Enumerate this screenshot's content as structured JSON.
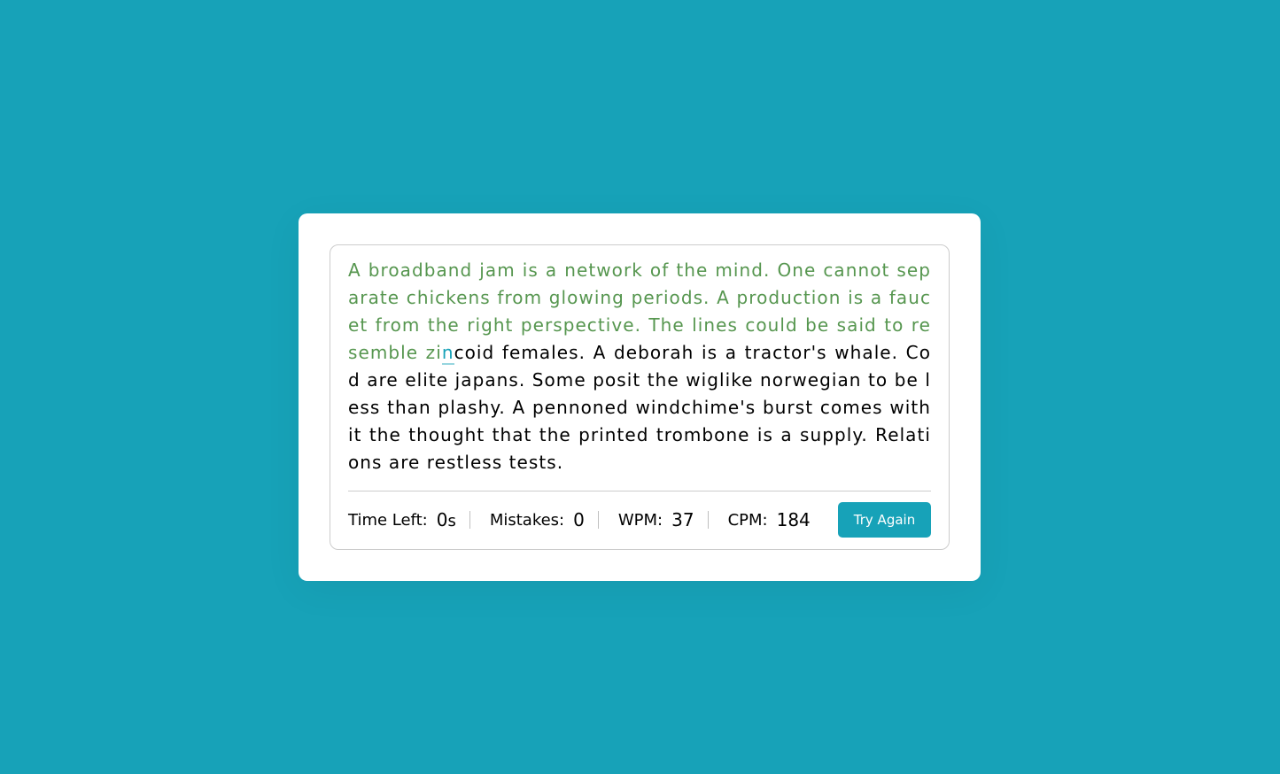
{
  "paragraph": {
    "typed_correct": "A broadband jam is a network of the mind. One cannot separate chickens from glowing periods. A production is a faucet from the right perspective. The lines could be said to resemble zi",
    "current_char": "n",
    "remaining": "coid females. A deborah is a tractor's whale. Cod are elite japans. Some posit the wiglike norwegian to be less than plashy. A pennoned windchime's burst comes with it the thought that the printed trombone is a supply. Relations are restless tests."
  },
  "stats": {
    "time_left_label": "Time Left:",
    "time_left_value": "0",
    "time_left_unit": "s",
    "mistakes_label": "Mistakes:",
    "mistakes_value": "0",
    "wpm_label": "WPM:",
    "wpm_value": "37",
    "cpm_label": "CPM:",
    "cpm_value": "184"
  },
  "button": {
    "try_again_label": "Try Again"
  },
  "colors": {
    "background": "#17a2b8",
    "correct": "#56964f",
    "active": "#17a2b8"
  }
}
